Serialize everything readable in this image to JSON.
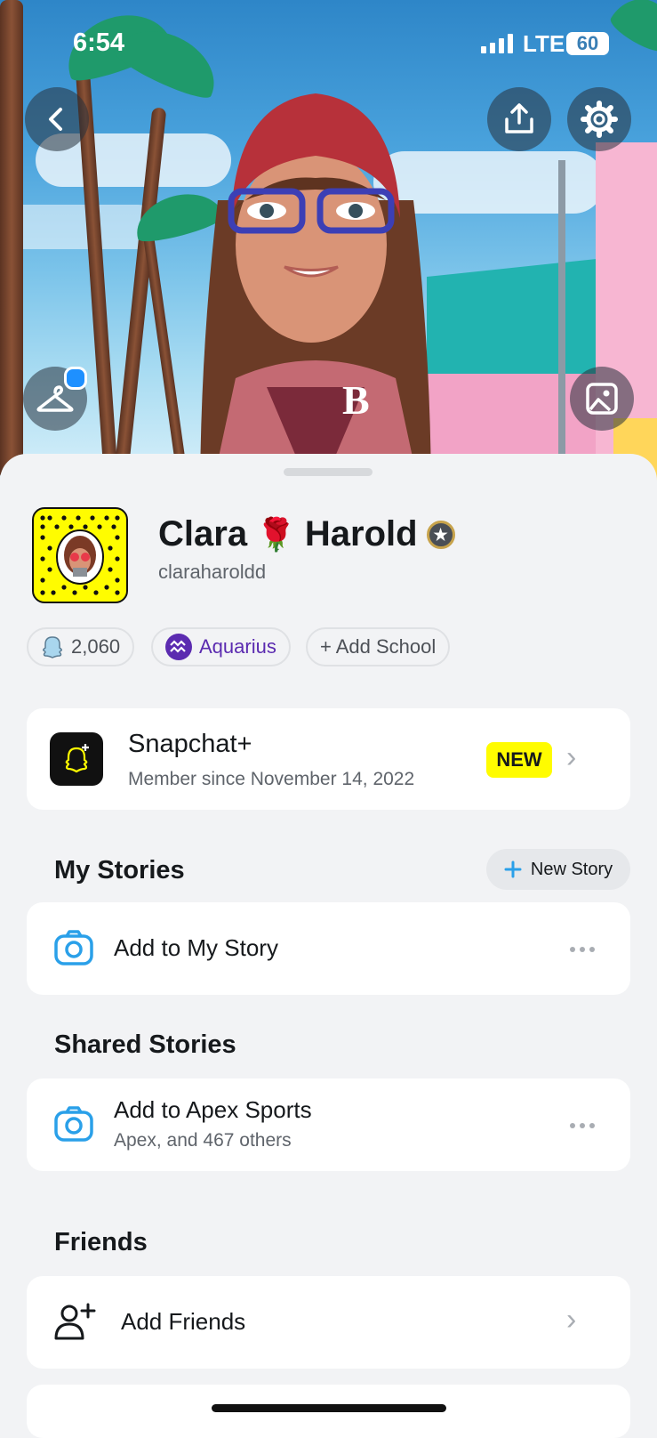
{
  "status_bar": {
    "time": "6:54",
    "network": "LTE",
    "battery": "60"
  },
  "profile": {
    "first_name": "Clara",
    "name_emoji": "🌹",
    "last_name": "Harold",
    "username": "claraharoldd",
    "snap_score": "2,060",
    "zodiac": "Aquarius",
    "add_school": "+ Add School"
  },
  "snapchat_plus": {
    "title": "Snapchat+",
    "subtitle": "Member since November 14, 2022",
    "badge": "NEW"
  },
  "my_stories": {
    "title": "My Stories",
    "new_story_button": "New Story",
    "add_to_story": "Add to My Story"
  },
  "shared_stories": {
    "title": "Shared Stories",
    "item_title": "Add to Apex Sports",
    "item_subtitle": "Apex, and 467 others"
  },
  "friends": {
    "title": "Friends",
    "add_friends": "Add Friends"
  },
  "colors": {
    "accent_blue": "#2aa0e9",
    "snap_yellow": "#fffc00",
    "zodiac_purple": "#5b2bb0"
  }
}
